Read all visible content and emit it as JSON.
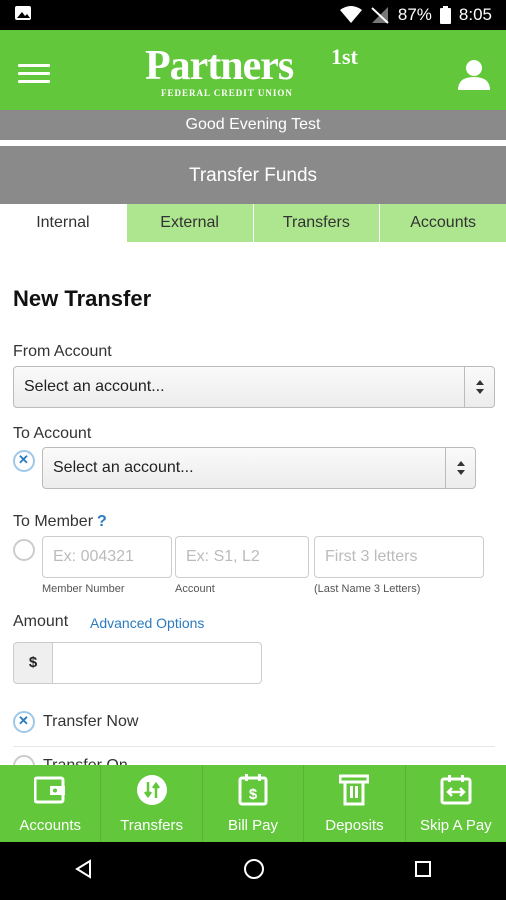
{
  "status_bar": {
    "battery": "87%",
    "time": "8:05"
  },
  "header": {
    "logo_text": "Partners",
    "logo_sup": "1st",
    "logo_sub": "FEDERAL CREDIT UNION"
  },
  "greeting": "Good Evening Test",
  "page_title": "Transfer Funds",
  "tabs": [
    {
      "label": "Internal"
    },
    {
      "label": "External"
    },
    {
      "label": "Transfers"
    },
    {
      "label": "Accounts"
    }
  ],
  "form": {
    "heading": "New Transfer",
    "from_label": "From Account",
    "from_value": "Select an account...",
    "to_label": "To Account",
    "to_value": "Select an account...",
    "to_member_label": "To Member",
    "to_member_help": "?",
    "member_number_placeholder": "Ex: 004321",
    "account_placeholder": "Ex: S1, L2",
    "letters_placeholder": "First  3  letters",
    "member_number_hint": "Member Number",
    "account_hint": "Account",
    "letters_hint": "(Last Name  3  Letters)",
    "amount_label": "Amount",
    "advanced_options": "Advanced Options",
    "currency": "$",
    "amount_value": "",
    "transfer_now": "Transfer Now",
    "transfer_later": "Transfer On..."
  },
  "bottom_nav": [
    {
      "label": "Accounts",
      "icon": "wallet-icon"
    },
    {
      "label": "Transfers",
      "icon": "transfer-arrows-icon"
    },
    {
      "label": "Bill Pay",
      "icon": "calendar-dollar-icon"
    },
    {
      "label": "Deposits",
      "icon": "deposit-icon"
    },
    {
      "label": "Skip A Pay",
      "icon": "skip-pay-icon"
    }
  ],
  "colors": {
    "brand_green": "#62c73b",
    "tab_green": "#aee68f",
    "gray_band": "#8a8a8a",
    "link_blue": "#2a7bc0"
  }
}
